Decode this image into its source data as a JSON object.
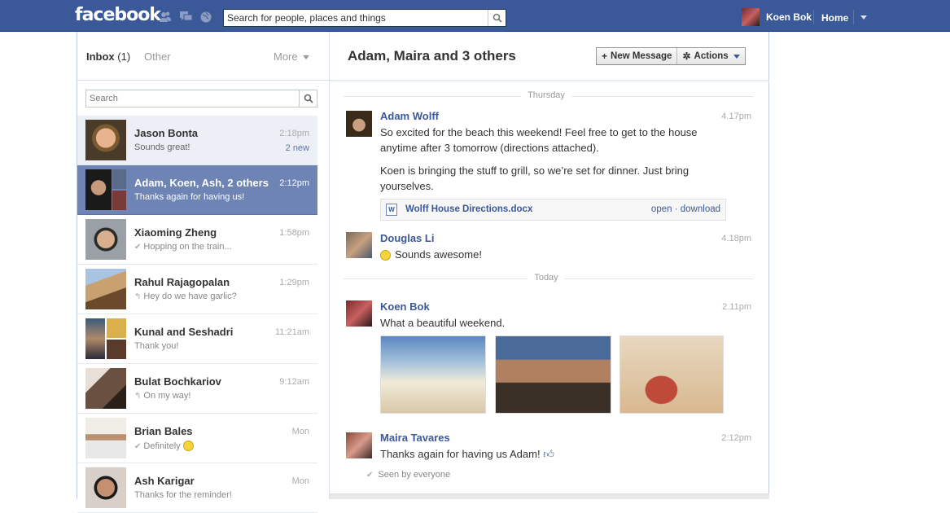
{
  "topbar": {
    "logo": "facebook",
    "search_placeholder": "Search for people, places and things",
    "user_name": "Koen Bok",
    "home_label": "Home",
    "icons": [
      "friends-icon",
      "messages-icon",
      "notifications-globe-icon",
      "search-icon"
    ]
  },
  "sidebar": {
    "inbox_label": "Inbox",
    "inbox_count": "(1)",
    "other_label": "Other",
    "more_label": "More",
    "search_placeholder": "Search",
    "threads": [
      {
        "name": "Jason Bonta",
        "snippet": "Sounds great!",
        "time": "2:18pm",
        "badge": "2 new",
        "state": "unread",
        "snippet_icon": ""
      },
      {
        "name": "Adam, Koen, Ash, 2 others",
        "snippet": "Thanks again for having us!",
        "time": "2:12pm",
        "badge": "",
        "state": "selected",
        "snippet_icon": ""
      },
      {
        "name": "Xiaoming Zheng",
        "snippet": "Hopping on the train...",
        "time": "1:58pm",
        "badge": "",
        "state": "normal",
        "snippet_icon": "✔"
      },
      {
        "name": "Rahul Rajagopalan",
        "snippet": "Hey do we have garlic?",
        "time": "1:29pm",
        "badge": "",
        "state": "normal",
        "snippet_icon": "↰"
      },
      {
        "name": "Kunal and Seshadri",
        "snippet": "Thank you!",
        "time": "11:21am",
        "badge": "",
        "state": "normal",
        "snippet_icon": ""
      },
      {
        "name": "Bulat Bochkariov",
        "snippet": "On my way!",
        "time": "9:12am",
        "badge": "",
        "state": "normal",
        "snippet_icon": "↰"
      },
      {
        "name": "Brian Bales",
        "snippet": "Definitely",
        "time": "Mon",
        "badge": "",
        "state": "normal",
        "snippet_icon": "✔"
      },
      {
        "name": "Ash Karigar",
        "snippet": "Thanks for the reminder!",
        "time": "Mon",
        "badge": "",
        "state": "normal",
        "snippet_icon": ""
      }
    ]
  },
  "conversation": {
    "title": "Adam, Maira and 3 others",
    "new_message_label": "New Message",
    "actions_label": "Actions",
    "day_thursday": "Thursday",
    "day_today": "Today",
    "messages": [
      {
        "sender": "Adam Wolff",
        "time": "4.17pm",
        "text1": "So excited for the beach this weekend! Feel free to get to the house anytime after 3 tomorrow (directions attached).",
        "text2": "Koen is bringing the stuff to grill, so we’re set for dinner. Just bring yourselves."
      },
      {
        "sender": "Douglas Li",
        "time": "4.18pm",
        "text1": "Sounds awesome!"
      },
      {
        "sender": "Koen Bok",
        "time": "2.11pm",
        "text1": "What a beautiful weekend."
      },
      {
        "sender": "Maira Tavares",
        "time": "2:12pm",
        "text1": "Thanks again for having us Adam!"
      }
    ],
    "attachment": {
      "filename": "Wolff House Directions.docx",
      "open_label": "open",
      "separator": "·",
      "download_label": "download"
    },
    "seen_text": "Seen by everyone"
  },
  "colors": {
    "brand": "#3b5998",
    "selected_thread": "#6d84b4",
    "unread_thread": "#eceff5"
  }
}
